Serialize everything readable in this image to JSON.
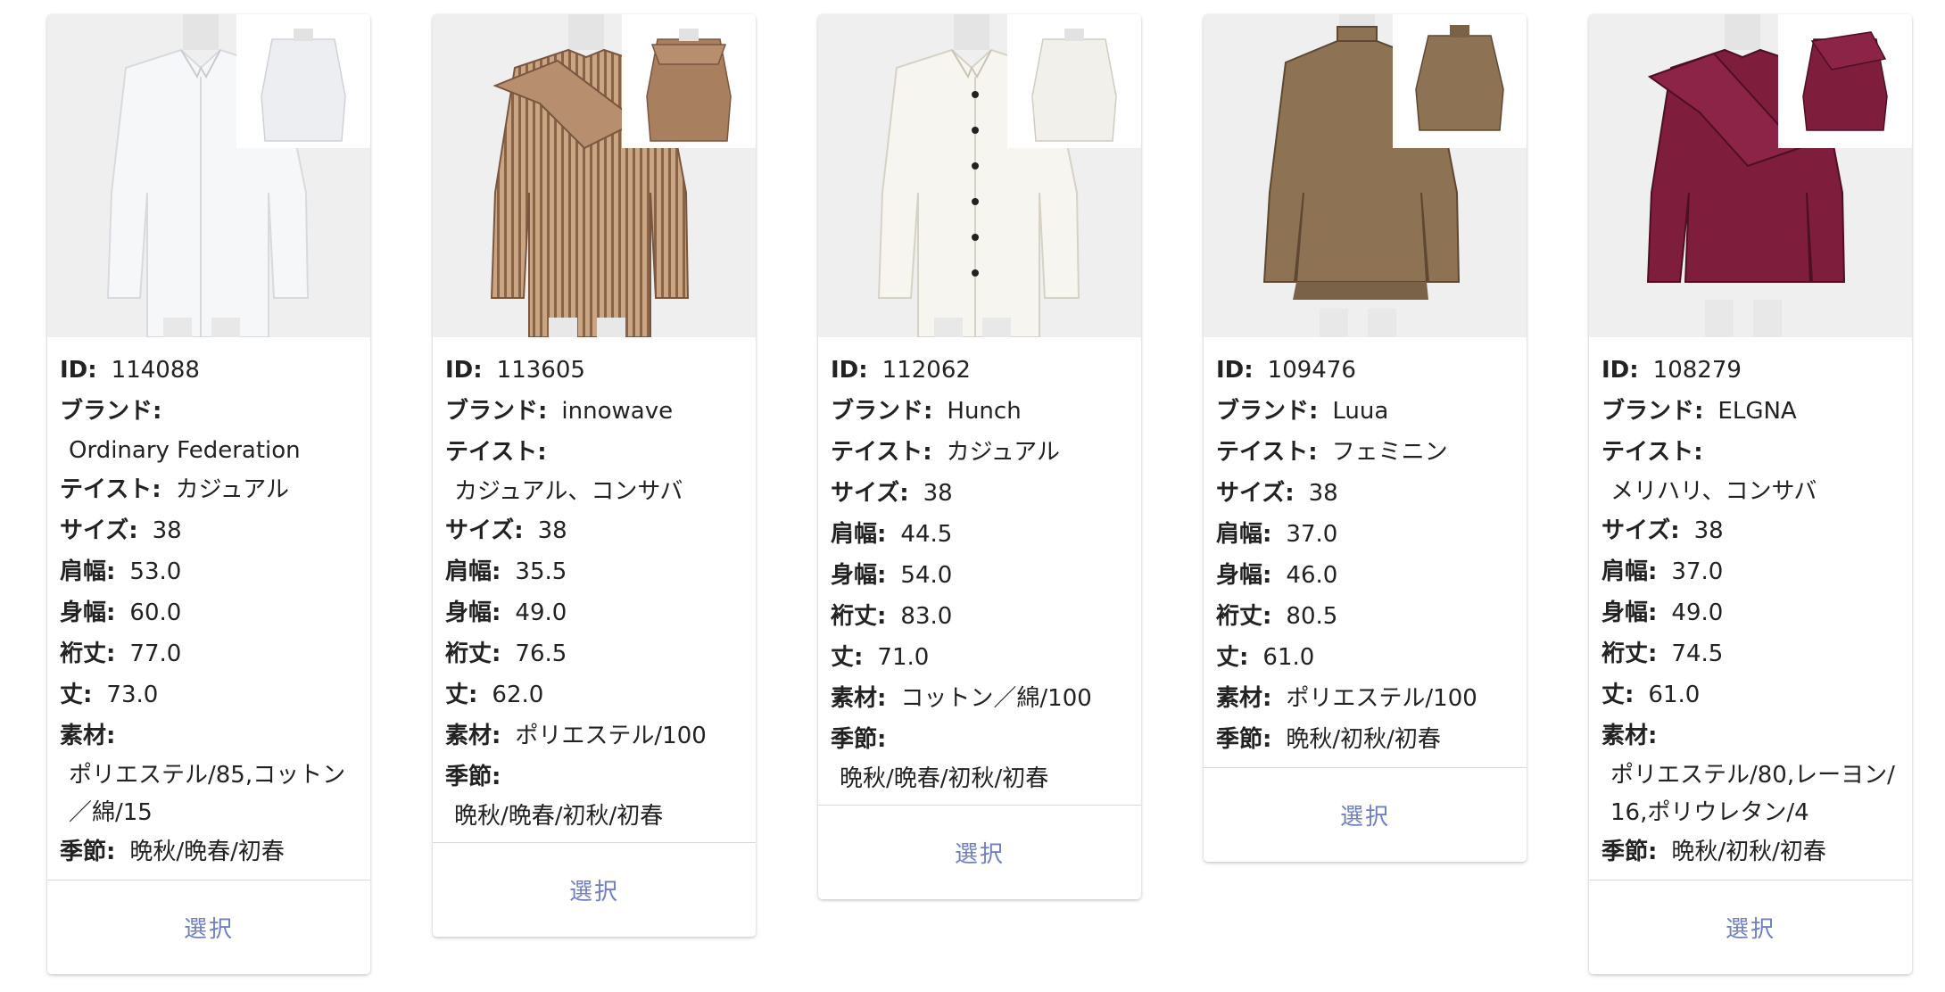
{
  "cards": [
    {
      "id_label": "ID:",
      "id": "114088",
      "brand_label": "ブランド:",
      "brand": "Ordinary Federation",
      "taste_label": "テイスト:",
      "taste": "カジュアル",
      "size_label": "サイズ:",
      "size": "38",
      "shoulder_label": "肩幅:",
      "shoulder": "53.0",
      "body_label": "身幅:",
      "body": "60.0",
      "sleeve_label": "裄丈:",
      "sleeve": "77.0",
      "length_label": "丈:",
      "length": "73.0",
      "material_label": "素材:",
      "material": "ポリエステル/85,コットン／綿/15",
      "season_label": "季節:",
      "season": "晩秋/晩春/初春",
      "select_label": "選択",
      "colors": {
        "main": "#f1f2f4",
        "shade": "#d7d9de"
      }
    },
    {
      "id_label": "ID:",
      "id": "113605",
      "brand_label": "ブランド:",
      "brand": "innowave",
      "taste_label": "テイスト:",
      "taste": "カジュアル、コンサバ",
      "size_label": "サイズ:",
      "size": "38",
      "shoulder_label": "肩幅:",
      "shoulder": "35.5",
      "body_label": "身幅:",
      "body": "49.0",
      "sleeve_label": "裄丈:",
      "sleeve": "76.5",
      "length_label": "丈:",
      "length": "62.0",
      "material_label": "素材:",
      "material": "ポリエステル/100",
      "season_label": "季節:",
      "season": "晩秋/晩春/初秋/初春",
      "select_label": "選択",
      "colors": {
        "main": "#b78f6f",
        "shade": "#8a6248"
      }
    },
    {
      "id_label": "ID:",
      "id": "112062",
      "brand_label": "ブランド:",
      "brand": "Hunch",
      "taste_label": "テイスト:",
      "taste": "カジュアル",
      "size_label": "サイズ:",
      "size": "38",
      "shoulder_label": "肩幅:",
      "shoulder": "44.5",
      "body_label": "身幅:",
      "body": "54.0",
      "sleeve_label": "裄丈:",
      "sleeve": "83.0",
      "length_label": "丈:",
      "length": "71.0",
      "material_label": "素材:",
      "material": "コットン／綿/100",
      "season_label": "季節:",
      "season": "晩秋/晩春/初秋/初春",
      "select_label": "選択",
      "colors": {
        "main": "#f5f3ec",
        "shade": "#dcd8cc"
      }
    },
    {
      "id_label": "ID:",
      "id": "109476",
      "brand_label": "ブランド:",
      "brand": "Luua",
      "taste_label": "テイスト:",
      "taste": "フェミニン",
      "size_label": "サイズ:",
      "size": "38",
      "shoulder_label": "肩幅:",
      "shoulder": "37.0",
      "body_label": "身幅:",
      "body": "46.0",
      "sleeve_label": "裄丈:",
      "sleeve": "80.5",
      "length_label": "丈:",
      "length": "61.0",
      "material_label": "素材:",
      "material": "ポリエステル/100",
      "season_label": "季節:",
      "season": "晩秋/初秋/初春",
      "select_label": "選択",
      "colors": {
        "main": "#8d7254",
        "shade": "#6a533b"
      }
    },
    {
      "id_label": "ID:",
      "id": "108279",
      "brand_label": "ブランド:",
      "brand": "ELGNA",
      "taste_label": "テイスト:",
      "taste": "メリハリ、コンサバ",
      "size_label": "サイズ:",
      "size": "38",
      "shoulder_label": "肩幅:",
      "shoulder": "37.0",
      "body_label": "身幅:",
      "body": "49.0",
      "sleeve_label": "裄丈:",
      "sleeve": "74.5",
      "length_label": "丈:",
      "length": "61.0",
      "material_label": "素材:",
      "material": "ポリエステル/80,レーヨン/16,ポリウレタン/4",
      "season_label": "季節:",
      "season": "晩秋/初秋/初春",
      "select_label": "選択",
      "colors": {
        "main": "#7e1e3c",
        "shade": "#5a1228"
      }
    }
  ]
}
